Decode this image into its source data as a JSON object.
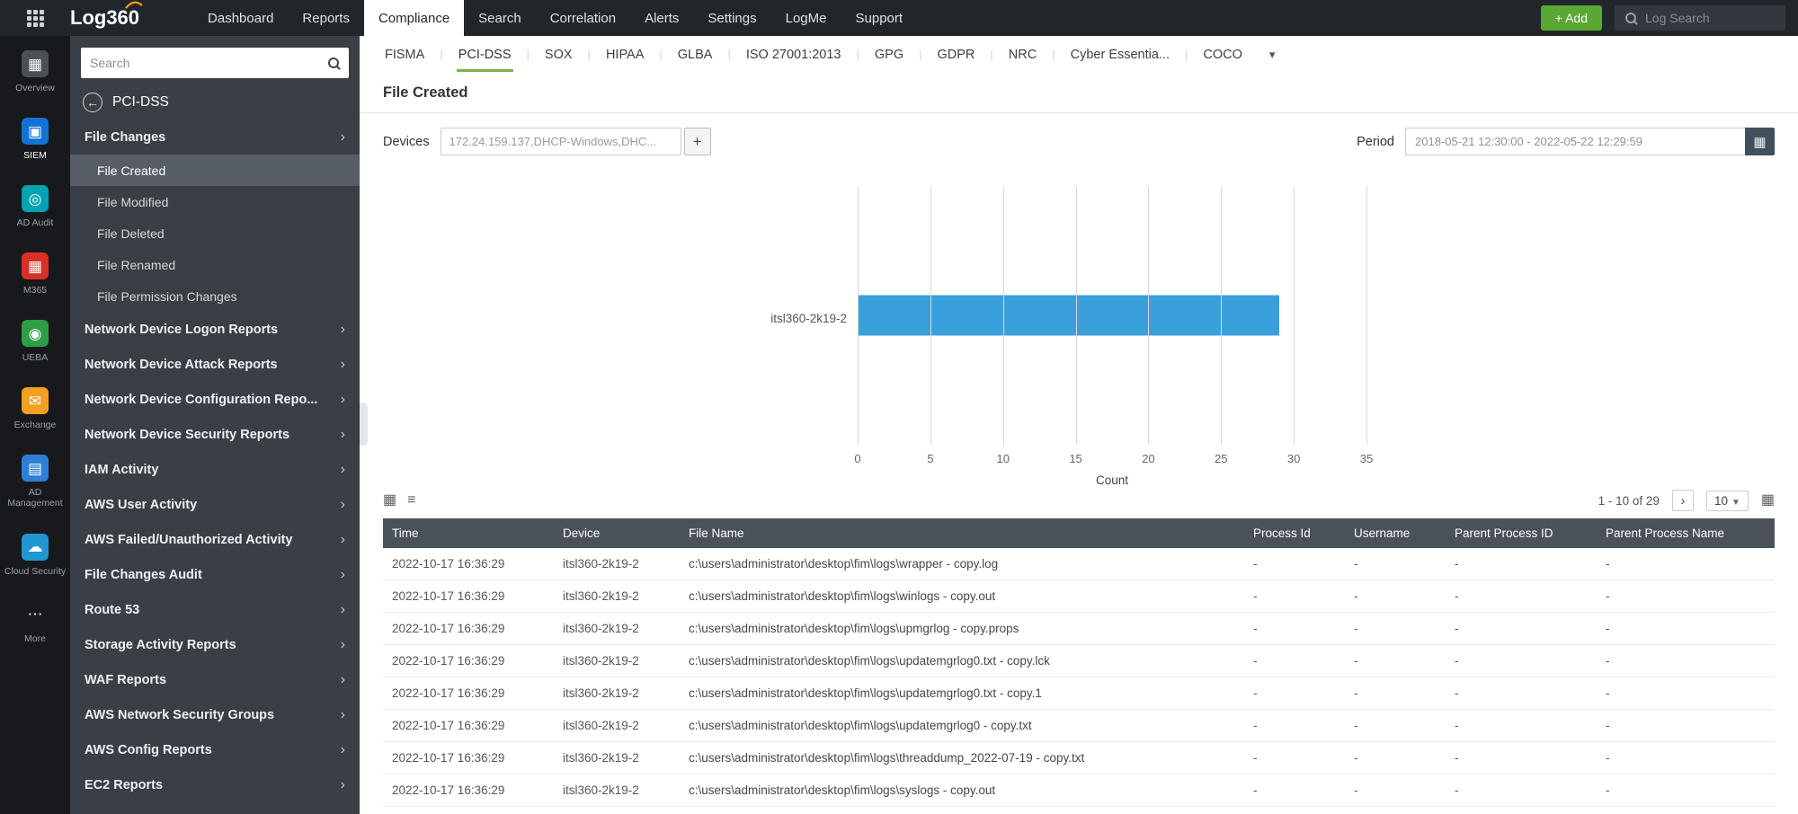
{
  "topbar": {
    "logo": "Log360",
    "nav": [
      {
        "label": "Dashboard"
      },
      {
        "label": "Reports"
      },
      {
        "label": "Compliance",
        "active": true
      },
      {
        "label": "Search"
      },
      {
        "label": "Correlation"
      },
      {
        "label": "Alerts"
      },
      {
        "label": "Settings"
      },
      {
        "label": "LogMe"
      },
      {
        "label": "Support"
      }
    ],
    "add_label": "+ Add",
    "log_search_placeholder": "Log Search"
  },
  "rail": {
    "items": [
      {
        "label": "Overview",
        "glyph": "▦",
        "color": "#4a5056"
      },
      {
        "label": "SIEM",
        "glyph": "▣",
        "color": "#1273d4",
        "active": true
      },
      {
        "label": "AD Audit",
        "glyph": "◎",
        "color": "#00a2b3"
      },
      {
        "label": "M365",
        "glyph": "▦",
        "color": "#d93025"
      },
      {
        "label": "UEBA",
        "glyph": "◉",
        "color": "#2e9e44"
      },
      {
        "label": "Exchange",
        "glyph": "✉",
        "color": "#f2a024"
      },
      {
        "label": "AD Management",
        "glyph": "▤",
        "color": "#2f7fd6"
      },
      {
        "label": "Cloud Security",
        "glyph": "☁",
        "color": "#2196d3"
      },
      {
        "label": "More",
        "glyph": "⋯",
        "color": "transparent"
      }
    ]
  },
  "sidebar": {
    "search_placeholder": "Search",
    "back_title": "PCI-DSS",
    "items": [
      {
        "label": "File Changes",
        "expandable": true
      },
      {
        "label": "File Created",
        "child": true,
        "selected": true
      },
      {
        "label": "File Modified",
        "child": true
      },
      {
        "label": "File Deleted",
        "child": true
      },
      {
        "label": "File Renamed",
        "child": true
      },
      {
        "label": "File Permission Changes",
        "child": true
      },
      {
        "label": "Network Device Logon Reports",
        "expandable": true
      },
      {
        "label": "Network Device Attack Reports",
        "expandable": true
      },
      {
        "label": "Network Device Configuration Repo...",
        "expandable": true
      },
      {
        "label": "Network Device Security Reports",
        "expandable": true
      },
      {
        "label": "IAM Activity",
        "expandable": true
      },
      {
        "label": "AWS User Activity",
        "expandable": true
      },
      {
        "label": "AWS Failed/Unauthorized Activity",
        "expandable": true
      },
      {
        "label": "File Changes Audit",
        "expandable": true
      },
      {
        "label": "Route 53",
        "expandable": true
      },
      {
        "label": "Storage Activity Reports",
        "expandable": true
      },
      {
        "label": "WAF Reports",
        "expandable": true
      },
      {
        "label": "AWS Network Security Groups",
        "expandable": true
      },
      {
        "label": "AWS Config Reports",
        "expandable": true
      },
      {
        "label": "EC2 Reports",
        "expandable": true
      }
    ]
  },
  "tabs": [
    {
      "label": "FISMA"
    },
    {
      "label": "PCI-DSS",
      "active": true
    },
    {
      "label": "SOX"
    },
    {
      "label": "HIPAA"
    },
    {
      "label": "GLBA"
    },
    {
      "label": "ISO 27001:2013"
    },
    {
      "label": "GPG"
    },
    {
      "label": "GDPR"
    },
    {
      "label": "NRC"
    },
    {
      "label": "Cyber Essentia..."
    },
    {
      "label": "COCO"
    }
  ],
  "page": {
    "title": "File Created",
    "devices_label": "Devices",
    "devices_value": "172.24.159.137,DHCP-Windows,DHC...",
    "plus_glyph": "+",
    "period_label": "Period",
    "period_value": "2018-05-21 12:30:00 - 2022-05-22 12:29:59"
  },
  "chart_data": {
    "type": "bar",
    "orientation": "horizontal",
    "categories": [
      "itsl360-2k19-2"
    ],
    "values": [
      29
    ],
    "xlabel": "Count",
    "xlim": [
      0,
      35
    ],
    "xticks": [
      0,
      5,
      10,
      15,
      20,
      25,
      30,
      35
    ],
    "bar_color": "#3aa0db",
    "grid": true
  },
  "table": {
    "pagination": "1 - 10 of 29",
    "page_size": "10",
    "columns": [
      "Time",
      "Device",
      "File Name",
      "Process Id",
      "Username",
      "Parent Process ID",
      "Parent Process Name"
    ],
    "rows": [
      [
        "2022-10-17 16:36:29",
        "itsl360-2k19-2",
        "c:\\users\\administrator\\desktop\\fim\\logs\\wrapper - copy.log",
        "-",
        "-",
        "-",
        "-"
      ],
      [
        "2022-10-17 16:36:29",
        "itsl360-2k19-2",
        "c:\\users\\administrator\\desktop\\fim\\logs\\winlogs - copy.out",
        "-",
        "-",
        "-",
        "-"
      ],
      [
        "2022-10-17 16:36:29",
        "itsl360-2k19-2",
        "c:\\users\\administrator\\desktop\\fim\\logs\\upmgrlog - copy.props",
        "-",
        "-",
        "-",
        "-"
      ],
      [
        "2022-10-17 16:36:29",
        "itsl360-2k19-2",
        "c:\\users\\administrator\\desktop\\fim\\logs\\updatemgrlog0.txt - copy.lck",
        "-",
        "-",
        "-",
        "-"
      ],
      [
        "2022-10-17 16:36:29",
        "itsl360-2k19-2",
        "c:\\users\\administrator\\desktop\\fim\\logs\\updatemgrlog0.txt - copy.1",
        "-",
        "-",
        "-",
        "-"
      ],
      [
        "2022-10-17 16:36:29",
        "itsl360-2k19-2",
        "c:\\users\\administrator\\desktop\\fim\\logs\\updatemgrlog0 - copy.txt",
        "-",
        "-",
        "-",
        "-"
      ],
      [
        "2022-10-17 16:36:29",
        "itsl360-2k19-2",
        "c:\\users\\administrator\\desktop\\fim\\logs\\threaddump_2022-07-19 - copy.txt",
        "-",
        "-",
        "-",
        "-"
      ],
      [
        "2022-10-17 16:36:29",
        "itsl360-2k19-2",
        "c:\\users\\administrator\\desktop\\fim\\logs\\syslogs - copy.out",
        "-",
        "-",
        "-",
        "-"
      ]
    ]
  }
}
